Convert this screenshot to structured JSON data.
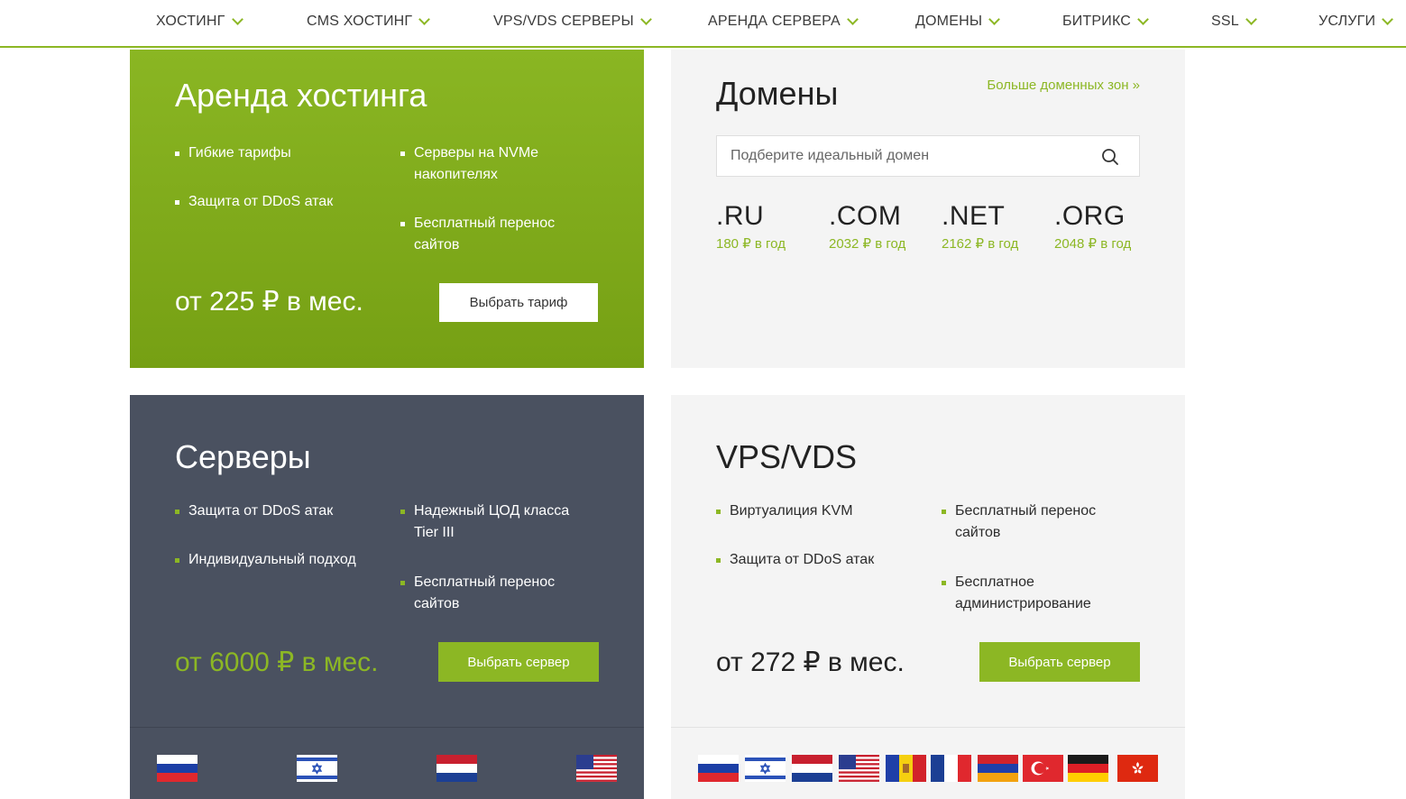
{
  "nav": {
    "items": [
      {
        "label": "ХОСТИНГ"
      },
      {
        "label": "CMS ХОСТИНГ"
      },
      {
        "label": "VPS/VDS СЕРВЕРЫ"
      },
      {
        "label": "АРЕНДА СЕРВЕРА"
      },
      {
        "label": "ДОМЕНЫ"
      },
      {
        "label": "БИТРИКС"
      },
      {
        "label": "SSL"
      },
      {
        "label": "УСЛУГИ"
      }
    ]
  },
  "hosting": {
    "title": "Аренда хостинга",
    "features": [
      "Гибкие тарифы",
      "Защита от DDoS атак",
      "Серверы на NVMe накопителях",
      "Бесплатный перенос сайтов"
    ],
    "price": "от 225 ₽ в мес.",
    "button": "Выбрать тариф"
  },
  "domains": {
    "title": "Домены",
    "more_link": "Больше доменных зон »",
    "search_placeholder": "Подберите идеальный домен",
    "zones": [
      {
        "name": ".RU",
        "price": "180 ₽ в год"
      },
      {
        "name": ".COM",
        "price": "2032 ₽ в год"
      },
      {
        "name": ".NET",
        "price": "2162 ₽ в год"
      },
      {
        "name": ".ORG",
        "price": "2048 ₽ в год"
      }
    ]
  },
  "servers": {
    "title": "Серверы",
    "features": [
      "Защита от DDoS атак",
      "Индивидуальный подход",
      "Надежный ЦОД класса Tier III",
      "Бесплатный перенос сайтов"
    ],
    "price": "от 6000 ₽ в мес.",
    "button": "Выбрать сервер",
    "flags": [
      "russia-flag",
      "israel-flag",
      "netherlands-flag",
      "usa-flag"
    ]
  },
  "vps": {
    "title": "VPS/VDS",
    "features": [
      "Виртуалиция KVM",
      "Защита от DDoS атак",
      "Бесплатный перенос сайтов",
      "Бесплатное администрирование"
    ],
    "price": "от 272 ₽ в мес.",
    "button": "Выбрать сервер",
    "flags": [
      "russia-flag",
      "israel-flag",
      "netherlands-flag",
      "usa-flag",
      "moldova-flag",
      "france-flag",
      "armenia-flag",
      "turkey-flag",
      "germany-flag",
      "hong-kong-flag"
    ]
  },
  "colors": {
    "accent": "#8cb724",
    "dark": "#4a5160",
    "light": "#f4f4f4"
  }
}
